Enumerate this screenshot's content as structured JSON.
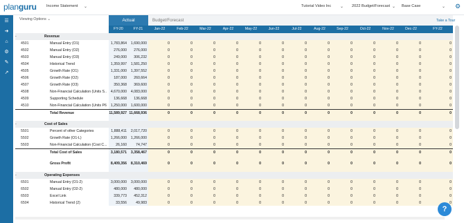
{
  "app": {
    "logo_a": "plan",
    "logo_b": "guru"
  },
  "topbar": {
    "statement": "Income Statement",
    "company": "Tutorial Video Inc",
    "budget": "2022 Budget/Forecast",
    "scenario": "Base Case"
  },
  "viewing_options": "Viewing Options",
  "tabs": {
    "actual": "Actual",
    "budget": "Budget/Forecast"
  },
  "take_tour": "Take a Tour",
  "columns": [
    "FY-20",
    "FY-21",
    "Jan-22",
    "Feb-22",
    "Mar-22",
    "Apr-22",
    "May-22",
    "Jun-22",
    "Jul-22",
    "Aug-22",
    "Sep-22",
    "Oct-22",
    "Nov-22",
    "Dec-22",
    "FY-22"
  ],
  "rows": [
    {
      "type": "section",
      "label": "Revenue"
    },
    {
      "type": "line",
      "code": "4501",
      "label": "Manual Entry (O1)",
      "values": [
        "1,783,864",
        "1,690,000",
        "0",
        "0",
        "0",
        "0",
        "0",
        "0",
        "0",
        "0",
        "0",
        "0",
        "0",
        "0",
        "0"
      ]
    },
    {
      "type": "line",
      "code": "4502",
      "label": "Manual Entry (O2)",
      "values": [
        "276,000",
        "276,000",
        "0",
        "0",
        "0",
        "0",
        "0",
        "0",
        "0",
        "0",
        "0",
        "0",
        "0",
        "0",
        "0"
      ]
    },
    {
      "type": "line",
      "code": "4503",
      "label": "Manual Entry (O3)",
      "values": [
        "249,000",
        "306,232",
        "0",
        "0",
        "0",
        "0",
        "0",
        "0",
        "0",
        "0",
        "0",
        "0",
        "0",
        "0",
        "0"
      ]
    },
    {
      "type": "line",
      "code": "4504",
      "label": "Historical Trend",
      "values": [
        "1,359,997",
        "1,581,250",
        "0",
        "0",
        "0",
        "0",
        "0",
        "0",
        "0",
        "0",
        "0",
        "0",
        "0",
        "0",
        "0"
      ]
    },
    {
      "type": "line",
      "code": "4505",
      "label": "Growth Rate (O1)",
      "values": [
        "1,331,000",
        "1,397,552",
        "0",
        "0",
        "0",
        "0",
        "0",
        "0",
        "0",
        "0",
        "0",
        "0",
        "0",
        "0",
        "0"
      ]
    },
    {
      "type": "line",
      "code": "4506",
      "label": "Growth Rate (O2)",
      "values": [
        "187,000",
        "260,664",
        "0",
        "0",
        "0",
        "0",
        "0",
        "0",
        "0",
        "0",
        "0",
        "0",
        "0",
        "0",
        "0"
      ]
    },
    {
      "type": "line",
      "code": "4507",
      "label": "Growth Rate (O3)",
      "values": [
        "350,368",
        "369,600",
        "0",
        "0",
        "0",
        "0",
        "0",
        "0",
        "0",
        "0",
        "0",
        "0",
        "0",
        "0",
        "0"
      ]
    },
    {
      "type": "line",
      "code": "4508",
      "label": "Non-Financial Calculation (Units S...",
      "values": [
        "4,670,000",
        "4,083,000",
        "0",
        "0",
        "0",
        "0",
        "0",
        "0",
        "0",
        "0",
        "0",
        "0",
        "0",
        "0",
        "0"
      ]
    },
    {
      "type": "line",
      "code": "4509",
      "label": "Supporting Schedule",
      "values": [
        "136,668",
        "136,668",
        "0",
        "0",
        "0",
        "0",
        "0",
        "0",
        "0",
        "0",
        "0",
        "0",
        "0",
        "0",
        "0"
      ]
    },
    {
      "type": "line",
      "code": "4510",
      "label": "Non-Financial Calculation (Units P6)",
      "values": [
        "1,250,000",
        "1,600,000",
        "0",
        "0",
        "0",
        "0",
        "0",
        "0",
        "0",
        "0",
        "0",
        "0",
        "0",
        "0",
        "0"
      ]
    },
    {
      "type": "total",
      "label": "Total Revenue",
      "values": [
        "11,589,927",
        "11,668,936",
        "0",
        "0",
        "0",
        "0",
        "0",
        "0",
        "0",
        "0",
        "0",
        "0",
        "0",
        "0",
        "0"
      ]
    },
    {
      "type": "spacer"
    },
    {
      "type": "section",
      "label": "Cost of Sales"
    },
    {
      "type": "line",
      "code": "5501",
      "label": "Percent of other Categories",
      "values": [
        "1,888,411",
        "2,017,720",
        "0",
        "0",
        "0",
        "0",
        "0",
        "0",
        "0",
        "0",
        "0",
        "0",
        "0",
        "0",
        "0"
      ]
    },
    {
      "type": "line",
      "code": "5502",
      "label": "Growth Rate (O1-L)",
      "values": [
        "1,266,000",
        "1,266,000",
        "0",
        "0",
        "0",
        "0",
        "0",
        "0",
        "0",
        "0",
        "0",
        "0",
        "0",
        "0",
        "0"
      ]
    },
    {
      "type": "line",
      "code": "5503",
      "label": "Non-Financial Calculation (Cost C...",
      "values": [
        "26,160",
        "74,747",
        "0",
        "0",
        "0",
        "0",
        "0",
        "0",
        "0",
        "0",
        "0",
        "0",
        "0",
        "0",
        "0"
      ]
    },
    {
      "type": "total",
      "label": "Total Cost of Sales",
      "values": [
        "3,180,571",
        "3,358,467",
        "0",
        "0",
        "0",
        "0",
        "0",
        "0",
        "0",
        "0",
        "0",
        "0",
        "0",
        "0",
        "0"
      ]
    },
    {
      "type": "spacer"
    },
    {
      "type": "gross",
      "label": "Gross Profit",
      "values": [
        "8,409,356",
        "8,310,469",
        "0",
        "0",
        "0",
        "0",
        "0",
        "0",
        "0",
        "0",
        "0",
        "0",
        "0",
        "0",
        "0"
      ]
    },
    {
      "type": "spacer"
    },
    {
      "type": "section",
      "label": "Operating Expenses"
    },
    {
      "type": "line",
      "code": "6501",
      "label": "Manual Entry (O1-2)",
      "values": [
        "3,000,000",
        "3,000,000",
        "0",
        "0",
        "0",
        "0",
        "0",
        "0",
        "0",
        "0",
        "0",
        "0",
        "0",
        "0",
        "0"
      ]
    },
    {
      "type": "line",
      "code": "6502",
      "label": "Manual Entry (O2-2)",
      "values": [
        "480,000",
        "480,000",
        "0",
        "0",
        "0",
        "0",
        "0",
        "0",
        "0",
        "0",
        "0",
        "0",
        "0",
        "0",
        "0"
      ]
    },
    {
      "type": "line",
      "code": "6503",
      "label": "Excel Link",
      "values": [
        "339,773",
        "452,312",
        "0",
        "0",
        "0",
        "0",
        "0",
        "0",
        "0",
        "0",
        "0",
        "0",
        "0",
        "0",
        "0"
      ]
    },
    {
      "type": "line",
      "code": "6504",
      "label": "Historical Trend (2)",
      "values": [
        "33,556",
        "49,983",
        "0",
        "0",
        "0",
        "0",
        "0",
        "0",
        "0",
        "0",
        "0",
        "0",
        "0",
        "0",
        "0"
      ]
    }
  ],
  "help": "?"
}
